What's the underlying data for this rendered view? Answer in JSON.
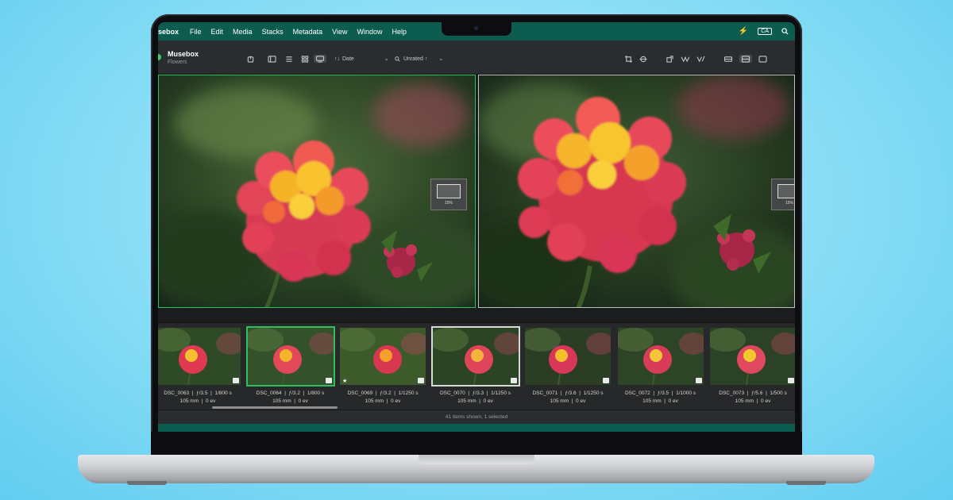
{
  "menubar": {
    "app_name": "sebox",
    "items": [
      "File",
      "Edit",
      "Media",
      "Stacks",
      "Metadata",
      "View",
      "Window",
      "Help"
    ],
    "ca_badge": "CA"
  },
  "toolbar": {
    "library_title": "Musebox",
    "library_subtitle": "Flowers",
    "sort_label": "Date",
    "sort_prefix": "↑↓",
    "search_label": "Unrated ↑"
  },
  "viewer": {
    "left_zoom": "15%",
    "right_zoom": "15%"
  },
  "filmstrip": {
    "items": [
      {
        "name": "DSC_0063",
        "aperture": "ƒ/3.5",
        "shutter": "1/800 s",
        "focal": "105 mm",
        "ev": "0 ev",
        "star": false,
        "selected": ""
      },
      {
        "name": "DSC_0064",
        "aperture": "ƒ/3.2",
        "shutter": "1/800 s",
        "focal": "105 mm",
        "ev": "0 ev",
        "star": false,
        "selected": "green"
      },
      {
        "name": "DSC_0069",
        "aperture": "ƒ/3.2",
        "shutter": "1/1250 s",
        "focal": "105 mm",
        "ev": "0 ev",
        "star": true,
        "selected": ""
      },
      {
        "name": "DSC_0070",
        "aperture": "ƒ/3.3",
        "shutter": "1/1250 s",
        "focal": "105 mm",
        "ev": "0 ev",
        "star": false,
        "selected": "white"
      },
      {
        "name": "DSC_0071",
        "aperture": "ƒ/3.6",
        "shutter": "1/1250 s",
        "focal": "105 mm",
        "ev": "0 ev",
        "star": false,
        "selected": ""
      },
      {
        "name": "DSC_0072",
        "aperture": "ƒ/3.5",
        "shutter": "1/1000 s",
        "focal": "105 mm",
        "ev": "0 ev",
        "star": false,
        "selected": ""
      },
      {
        "name": "DSC_0073",
        "aperture": "ƒ/5.6",
        "shutter": "1/500 s",
        "focal": "105 mm",
        "ev": "0 ev",
        "star": false,
        "selected": ""
      }
    ]
  },
  "status": {
    "text": "41 items shown, 1 selected"
  },
  "colors": {
    "accent_teal": "#0c5c50",
    "selection_green": "#2fbf5c"
  }
}
